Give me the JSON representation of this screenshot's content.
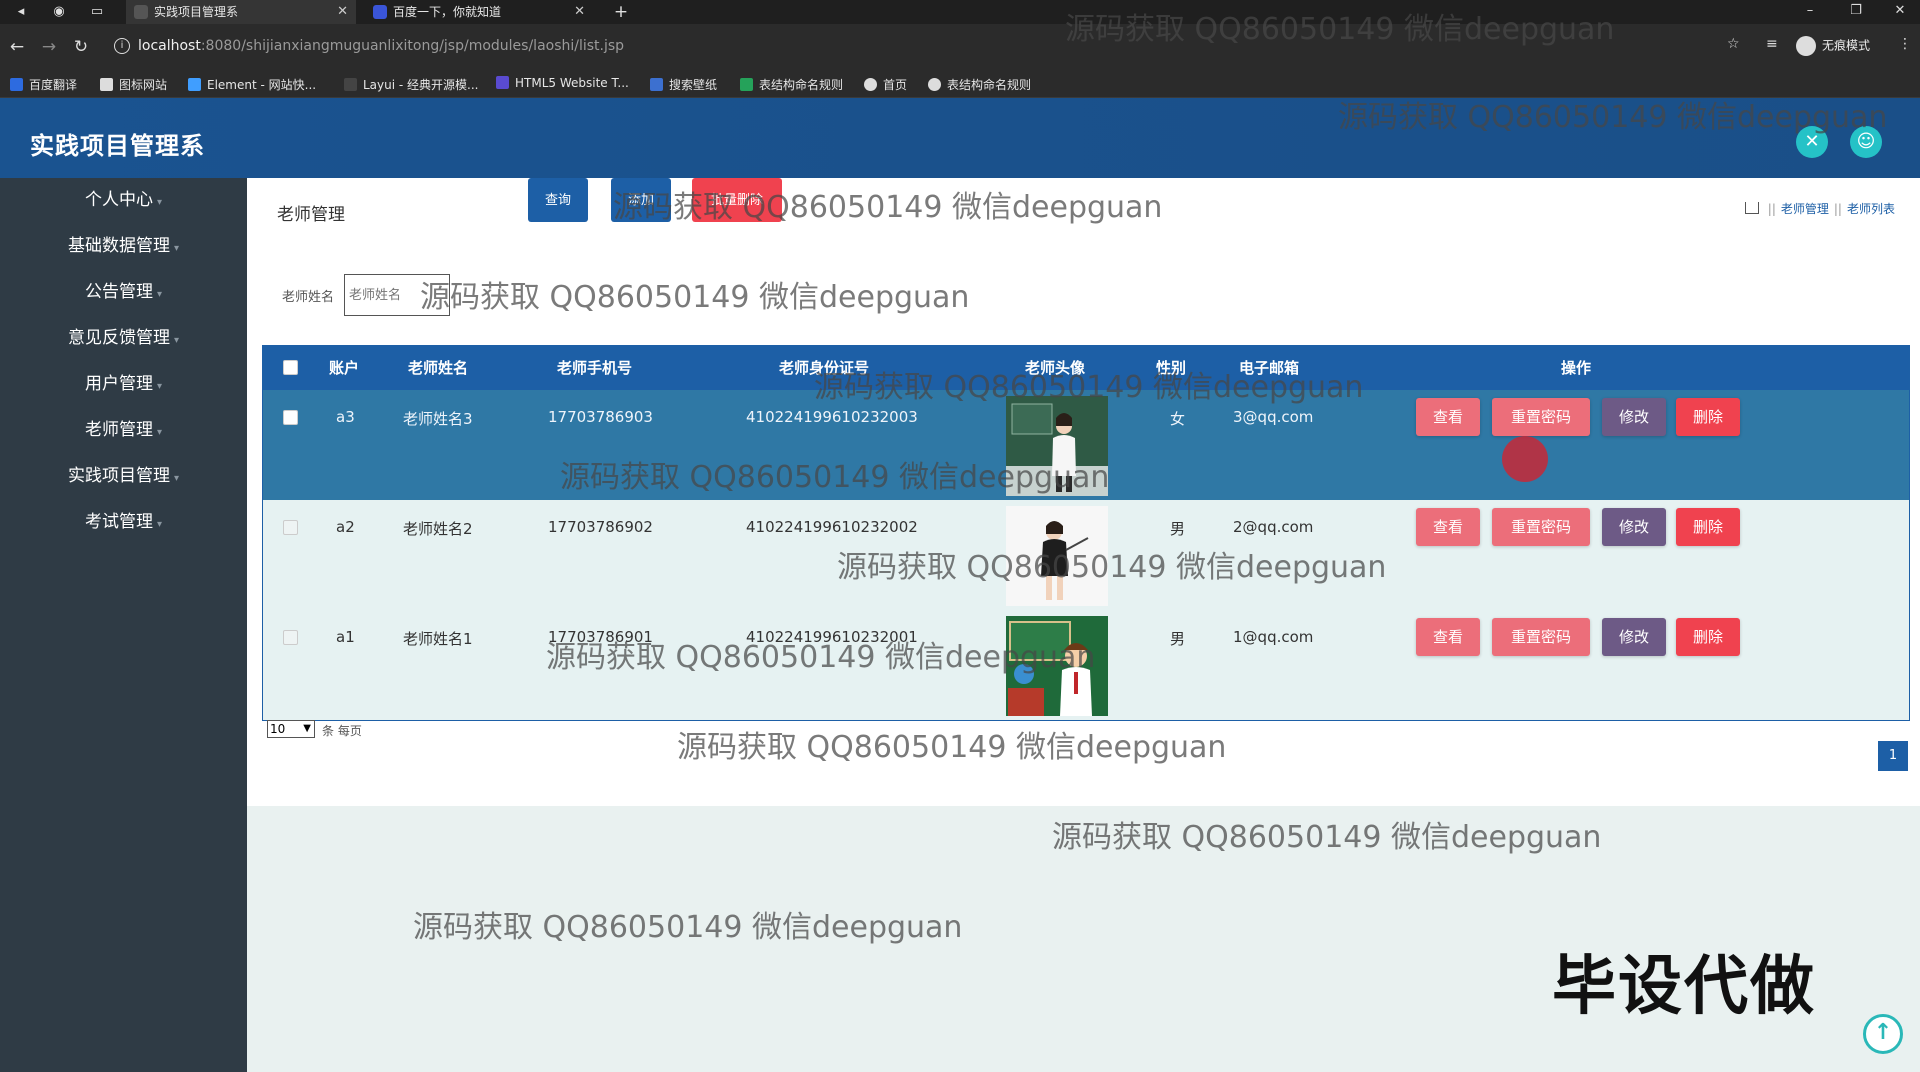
{
  "browser": {
    "tabs": [
      {
        "title": "实践项目管理系",
        "active": true
      },
      {
        "title": "百度一下，你就知道",
        "active": false
      }
    ],
    "url_host": "localhost",
    "url_path": ":8080/shijianxiangmuguanlixitong/jsp/modules/laoshi/list.jsp",
    "incognito_label": "无痕模式",
    "bookmarks": [
      "百度翻译",
      "图标网站",
      "Element - 网站快...",
      "Layui - 经典开源模...",
      "HTML5 Website T...",
      "搜索壁纸",
      "表结构命名规则",
      "首页",
      "表结构命名规则"
    ]
  },
  "app": {
    "title": "实践项目管理系"
  },
  "sidebar": {
    "items": [
      {
        "label": "个人中心"
      },
      {
        "label": "基础数据管理"
      },
      {
        "label": "公告管理"
      },
      {
        "label": "意见反馈管理"
      },
      {
        "label": "用户管理"
      },
      {
        "label": "老师管理"
      },
      {
        "label": "实践项目管理"
      },
      {
        "label": "考试管理"
      }
    ]
  },
  "page": {
    "title": "老师管理",
    "breadcrumb": [
      "老师管理",
      "老师列表"
    ]
  },
  "search": {
    "label": "老师姓名",
    "placeholder": "老师姓名",
    "query_button": "查询",
    "add_button": "添加",
    "batch_delete_button": "批量删除"
  },
  "table": {
    "headers": [
      "账户",
      "老师姓名",
      "老师手机号",
      "老师身份证号",
      "老师头像",
      "性别",
      "电子邮箱",
      "操作"
    ],
    "rows": [
      {
        "account": "a3",
        "name": "老师姓名3",
        "phone": "17703786903",
        "id_card": "410224199610232003",
        "gender": "女",
        "email": "3@qq.com",
        "avatar": "teacher-at-blackboard"
      },
      {
        "account": "a2",
        "name": "老师姓名2",
        "phone": "17703786902",
        "id_card": "410224199610232002",
        "gender": "男",
        "email": "2@qq.com",
        "avatar": "teacher-with-pointer"
      },
      {
        "account": "a1",
        "name": "老师姓名1",
        "phone": "17703786901",
        "id_card": "410224199610232001",
        "gender": "男",
        "email": "1@qq.com",
        "avatar": "teachers-day-cartoon"
      }
    ],
    "actions": {
      "view": "查看",
      "reset": "重置密码",
      "edit": "修改",
      "delete": "删除"
    }
  },
  "pagination": {
    "page_size": "10",
    "per_page_label": "条 每页",
    "current_page": "1"
  },
  "overlays": {
    "watermark": "源码获取 QQ86050149 微信deepguan",
    "bishe": "毕设代做"
  },
  "colors": {
    "header_blue": "#1a5390",
    "sidebar": "#2f3b45",
    "table_header": "#1d5fa6",
    "selected_row": "#2f78a5",
    "btn_pink": "#ec6e7a",
    "btn_purple": "#6d5a86",
    "btn_red": "#f0424f"
  }
}
